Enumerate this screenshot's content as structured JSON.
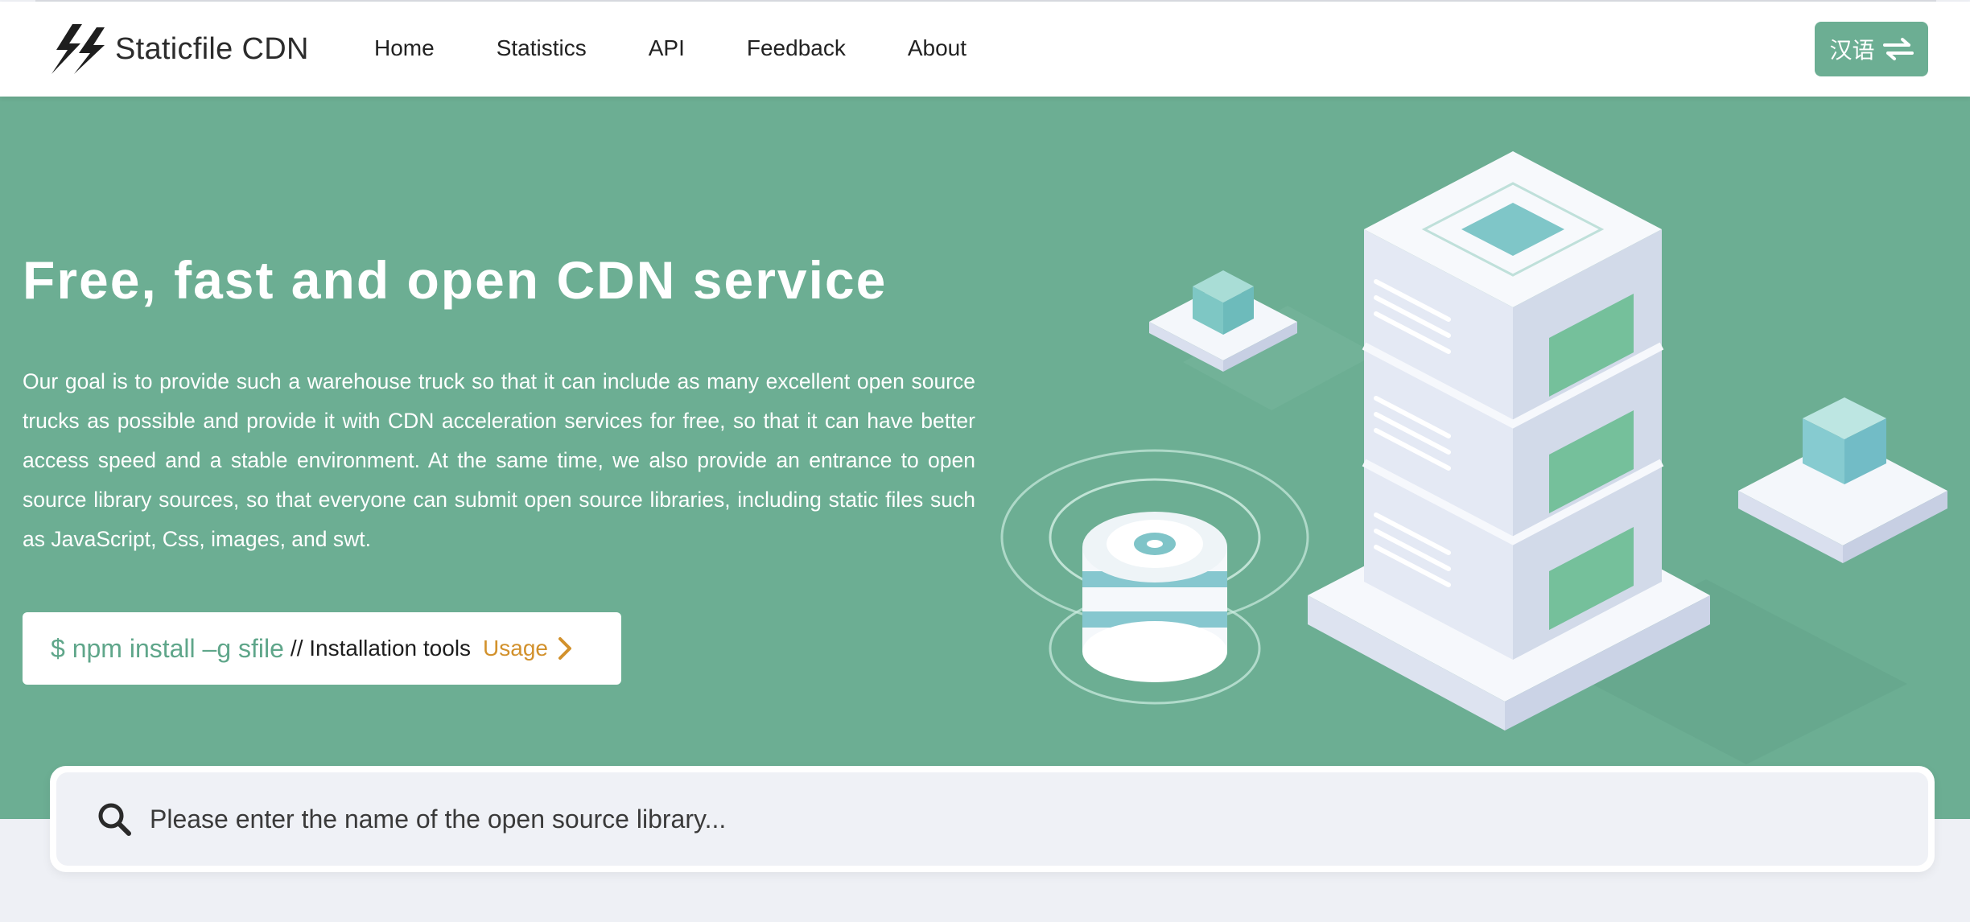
{
  "header": {
    "brand": "Staticfile CDN",
    "nav": [
      "Home",
      "Statistics",
      "API",
      "Feedback",
      "About"
    ],
    "language_button": "汉语"
  },
  "hero": {
    "title": "Free, fast and open CDN service",
    "description": "Our goal is to provide such a warehouse truck so that it can include as many excellent open source trucks as possible and provide it with CDN acceleration services for free, so that it can have better access speed and a stable environment. At the same time, we also provide an entrance to open source library sources, so that everyone can submit open source libraries, including static files such as JavaScript, Css, images, and swt.",
    "install": {
      "command": "$ npm install –g sfile",
      "note": "// Installation tools",
      "usage_label": "Usage"
    }
  },
  "search": {
    "placeholder": "Please enter the name of the open source library..."
  },
  "colors": {
    "brand_green": "#6cae93",
    "command_green": "#5fa68a",
    "usage_orange": "#d2912c",
    "page_background": "#eef0f5"
  },
  "icons": [
    "logo-lightning-icon",
    "swap-arrows-icon",
    "chevron-right-icon",
    "search-icon"
  ]
}
